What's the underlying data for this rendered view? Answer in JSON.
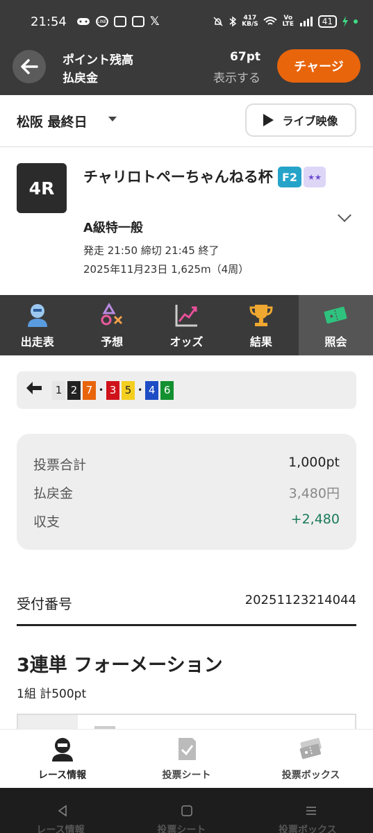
{
  "status_bar": {
    "time": "21:54",
    "speed_value": "417",
    "speed_unit": "KB/S",
    "vo_lte": "Vo LTE",
    "battery": "41"
  },
  "header": {
    "balance_label": "ポイント残高",
    "refund_label": "払戻金",
    "balance_value": "67pt",
    "show_label": "表示する",
    "charge_label": "チャージ"
  },
  "venue_bar": {
    "venue": "松阪 最終日",
    "live_label": "ライブ映像"
  },
  "race": {
    "number": "4R",
    "title": "チャリロトペーちゃんねる杯",
    "grade_badge": "F2",
    "class": "A級特一般",
    "start_info": "発走 21:50 締切 21:45 終了",
    "date_info": "2025年11月23日 1,625m（4周）"
  },
  "tabs": [
    {
      "label": "出走表",
      "icon": "rider-icon"
    },
    {
      "label": "予想",
      "icon": "prediction-icon"
    },
    {
      "label": "オッズ",
      "icon": "odds-chart-icon"
    },
    {
      "label": "結果",
      "icon": "trophy-icon"
    },
    {
      "label": "照会",
      "icon": "ticket-icon",
      "active": true
    }
  ],
  "combination": {
    "group1": [
      "1",
      "2",
      "7"
    ],
    "group2": [
      "3",
      "5"
    ],
    "group3": [
      "4",
      "6"
    ],
    "colors": {
      "1": "#ffffff",
      "2": "#222222",
      "7": "#e8650c",
      "3": "#d0121b",
      "5": "#f5cf1f",
      "4": "#1d4cc4",
      "6": "#13902f"
    }
  },
  "summary": {
    "total_label": "投票合計",
    "total_value": "1,000pt",
    "refund_label": "払戻金",
    "refund_value": "3,480円",
    "balance_label": "収支",
    "balance_value": "+2,480",
    "positive_color": "#1a7a5a"
  },
  "receipt": {
    "label": "受付番号",
    "number": "20251123214044"
  },
  "bet": {
    "title": "3連単 フォーメーション",
    "subtitle": "1組 計500pt"
  },
  "bottom_nav": [
    {
      "label": "レース情報",
      "icon": "rider-icon"
    },
    {
      "label": "投票シート",
      "icon": "sheet-icon"
    },
    {
      "label": "投票ボックス",
      "icon": "tickets-icon"
    }
  ],
  "sysnav_shadow": [
    "レース情報",
    "投票シート",
    "投票ボックス"
  ]
}
